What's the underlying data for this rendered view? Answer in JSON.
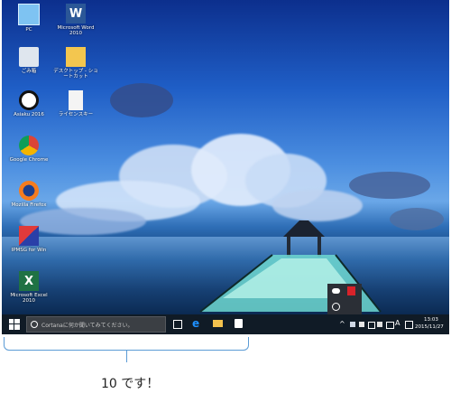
{
  "desktop_icons": [
    {
      "name": "pc-icon",
      "label": "PC",
      "kind": "pc"
    },
    {
      "name": "word-icon",
      "label": "Microsoft Word 2010",
      "kind": "word"
    },
    {
      "name": "recycle-bin-icon",
      "label": "ごみ箱",
      "kind": "bin"
    },
    {
      "name": "folder-icon",
      "label": "デスクトップ - ショートカット",
      "kind": "folder"
    },
    {
      "name": "app-2016-icon",
      "label": "Asiaku 2016",
      "kind": "app"
    },
    {
      "name": "license-doc-icon",
      "label": "ライセンスキー",
      "kind": "doc"
    },
    {
      "name": "chrome-icon",
      "label": "Google Chrome",
      "kind": "chrome"
    },
    {
      "name": "firefox-icon",
      "label": "Mozilla Firefox",
      "kind": "firefox"
    },
    {
      "name": "ipmsg-icon",
      "label": "IPMSG for Win",
      "kind": "ipmsg"
    },
    {
      "name": "excel-icon",
      "label": "Microsoft Excel 2010",
      "kind": "excel"
    }
  ],
  "taskbar": {
    "search_placeholder": "Cortanaに何か聞いてみてください。",
    "ime_label": "A",
    "clock_time": "13:03",
    "clock_date": "2015/11/27"
  },
  "annotation": {
    "caption": "10 です！"
  },
  "colors": {
    "taskbar": "#101b26",
    "bracket": "#5b9bd5",
    "edge_blue": "#1e90ff"
  }
}
